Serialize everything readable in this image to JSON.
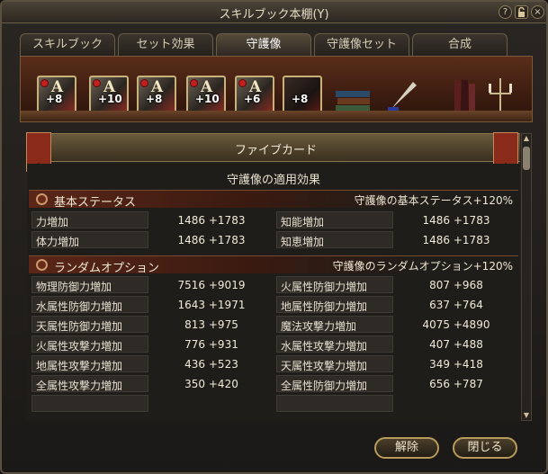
{
  "window": {
    "title": "スキルブック本棚(Y)",
    "help_icon": "?",
    "lock_icon": "lock-icon",
    "close_icon": "×"
  },
  "tabs": [
    {
      "label": "スキルブック"
    },
    {
      "label": "セット効果"
    },
    {
      "label": "守護像"
    },
    {
      "label": "守護像セット"
    },
    {
      "label": "合成"
    }
  ],
  "active_tab": "守護像",
  "shelf": {
    "cards": [
      {
        "letter": "A",
        "level": "+8"
      },
      {
        "letter": "A",
        "level": "+10"
      },
      {
        "letter": "A",
        "level": "+8"
      },
      {
        "letter": "A",
        "level": "+10"
      },
      {
        "letter": "A",
        "level": "+6"
      },
      {
        "letter": "",
        "level": "+8"
      }
    ],
    "decorations": [
      "books-icon",
      "quill-inkwell-icon",
      "bookends-icon",
      "candelabra-icon"
    ]
  },
  "banner": {
    "title": "ファイブカード"
  },
  "effects_title": "守護像の適用効果",
  "basic_section": {
    "label": "基本ステータス",
    "bonus": "守護像の基本ステータス+120%",
    "rows": [
      {
        "left_name": "力増加",
        "left_value": "1486 +1783",
        "right_name": "知能増加",
        "right_value": "1486 +1783"
      },
      {
        "left_name": "体力増加",
        "left_value": "1486 +1783",
        "right_name": "知恵増加",
        "right_value": "1486 +1783"
      }
    ]
  },
  "random_section": {
    "label": "ランダムオプション",
    "bonus": "守護像のランダムオプション+120%",
    "rows": [
      {
        "left_name": "物理防御力増加",
        "left_value": "7516 +9019",
        "right_name": "火属性防御力増加",
        "right_value": "807 +968"
      },
      {
        "left_name": "水属性防御力増加",
        "left_value": "1643 +1971",
        "right_name": "地属性防御力増加",
        "right_value": "637 +764"
      },
      {
        "left_name": "天属性防御力増加",
        "left_value": "813 +975",
        "right_name": "魔法攻撃力増加",
        "right_value": "4075 +4890"
      },
      {
        "left_name": "火属性攻撃力増加",
        "left_value": "776 +931",
        "right_name": "水属性攻撃力増加",
        "right_value": "407 +488"
      },
      {
        "left_name": "地属性攻撃力増加",
        "left_value": "436 +523",
        "right_name": "天属性攻撃力増加",
        "right_value": "349 +418"
      },
      {
        "left_name": "全属性攻撃力増加",
        "left_value": "350 +420",
        "right_name": "全属性防御力増加",
        "right_value": "656 +787"
      },
      {
        "left_name": "",
        "left_value": "",
        "right_name": "",
        "right_value": ""
      }
    ]
  },
  "buttons": {
    "release": "解除",
    "close": "閉じる"
  }
}
